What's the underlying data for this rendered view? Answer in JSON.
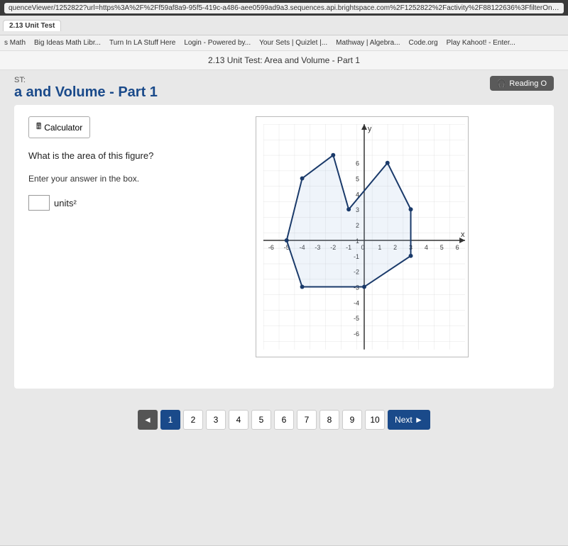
{
  "browser": {
    "url": "quenceViewer/1252822?url=https%3A%2F%2Ff59af8a9-95f5-419c-a486-aee0599ad9a3.sequences.api.brightspace.com%2F1252822%2Factivity%2F88122636%3FfilterOnDates",
    "tab_label": "2.13 Unit Test"
  },
  "bookmarks": [
    "s Math",
    "Big Ideas Math Libr...",
    "Turn In LA Stuff Here",
    "Login - Powered by...",
    "Your Sets | Quizlet |...",
    "Mathway | Algebra...",
    "Code.org",
    "Play Kahoot! - Enter..."
  ],
  "page_header": {
    "title": "2.13 Unit Test: Area and Volume - Part 1"
  },
  "test": {
    "label": "ST:",
    "title": "a and Volume - Part 1",
    "reading_button": "Reading O"
  },
  "question": {
    "calculator_label": "Calculator",
    "question_text": "What is the area of this figure?",
    "answer_note": "Enter your answer in the box.",
    "units_label": "units²"
  },
  "navigation": {
    "prev_label": "◄",
    "next_label": "Next ►",
    "pages": [
      "1",
      "2",
      "3",
      "4",
      "5",
      "6",
      "7",
      "8",
      "9",
      "10"
    ],
    "current_page": "1"
  }
}
